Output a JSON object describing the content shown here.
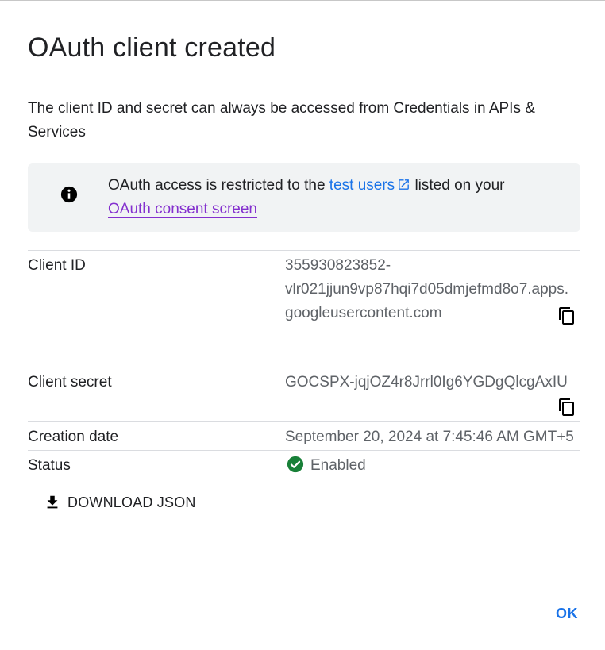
{
  "dialog": {
    "title": "OAuth client created",
    "subtitle": "The client ID and secret can always be accessed from Credentials in APIs & Services"
  },
  "banner": {
    "icon": "info-icon",
    "text_before": "OAuth access is restricted to the ",
    "link_test_users": "test users",
    "text_after": " listed on your ",
    "link_consent": "OAuth consent screen"
  },
  "details": {
    "client_id_label": "Client ID",
    "client_id_value": "355930823852-vlr021jjun9vp87hqi7d05dmjefmd8o7.apps.googleusercontent.com",
    "client_id_line1": "355930823852-",
    "client_id_line2": "vlr021jjun9vp87hqi7d05dmjefmd8o7.apps.",
    "client_id_line3": "googleusercontent.com",
    "client_secret_label": "Client secret",
    "client_secret_value": "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",
    "creation_date_label": "Creation date",
    "creation_date_value": "September 20, 2024 at 7:45:46 AM GMT+5",
    "status_label": "Status",
    "status_value": "Enabled"
  },
  "actions": {
    "download_label": "DOWNLOAD JSON",
    "ok_label": "OK"
  },
  "colors": {
    "link": "#1a73e8",
    "visited_link": "#8430ce",
    "status_ok": "#188038",
    "banner_bg": "#f1f3f4"
  }
}
